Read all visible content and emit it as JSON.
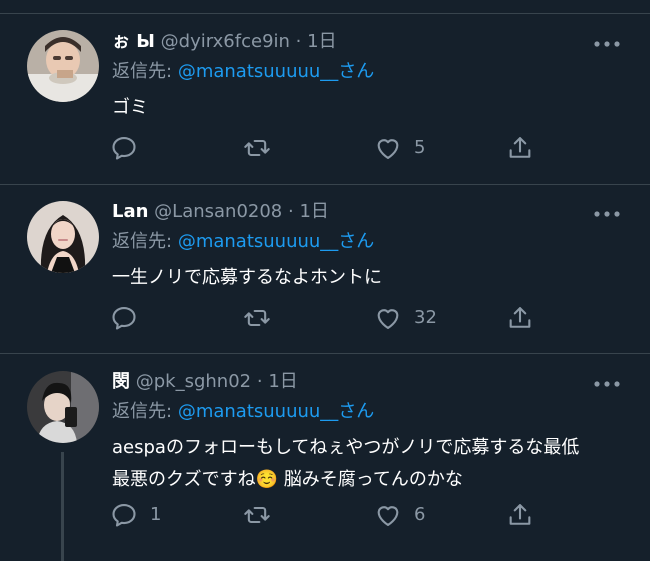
{
  "tweets": [
    {
      "display_name": "ぉ Ы",
      "handle": "@dyirx6fce9in",
      "separator": "·",
      "time": "1日",
      "reply_prefix": "返信先:",
      "reply_to": "@manatsuuuuu__さん",
      "text": "ゴミ",
      "reply_count": "",
      "retweet_count": "",
      "like_count": "5"
    },
    {
      "display_name": "Lan",
      "handle": "@Lansan0208",
      "separator": "·",
      "time": "1日",
      "reply_prefix": "返信先:",
      "reply_to": "@manatsuuuuu__さん",
      "text": "一生ノリで応募するなよホントに",
      "reply_count": "",
      "retweet_count": "",
      "like_count": "32"
    },
    {
      "display_name": "閔",
      "handle": "@pk_sghn02",
      "separator": "·",
      "time": "1日",
      "reply_prefix": "返信先:",
      "reply_to": "@manatsuuuuu__さん",
      "text_line1": "aespaのフォローもしてねぇやつがノリで応募するな最低",
      "text_line2": "最悪のクズですね☺️ 脳みそ腐ってんのかな",
      "reply_count": "1",
      "retweet_count": "",
      "like_count": "6"
    }
  ],
  "icons": {
    "more": "more-icon",
    "reply": "reply-icon",
    "retweet": "retweet-icon",
    "like": "like-icon",
    "share": "share-icon"
  },
  "colors": {
    "background": "#15202b",
    "divider": "#38444d",
    "secondary_text": "#8b98a5",
    "link": "#1d9bf0",
    "icon": "#8b98a5"
  }
}
